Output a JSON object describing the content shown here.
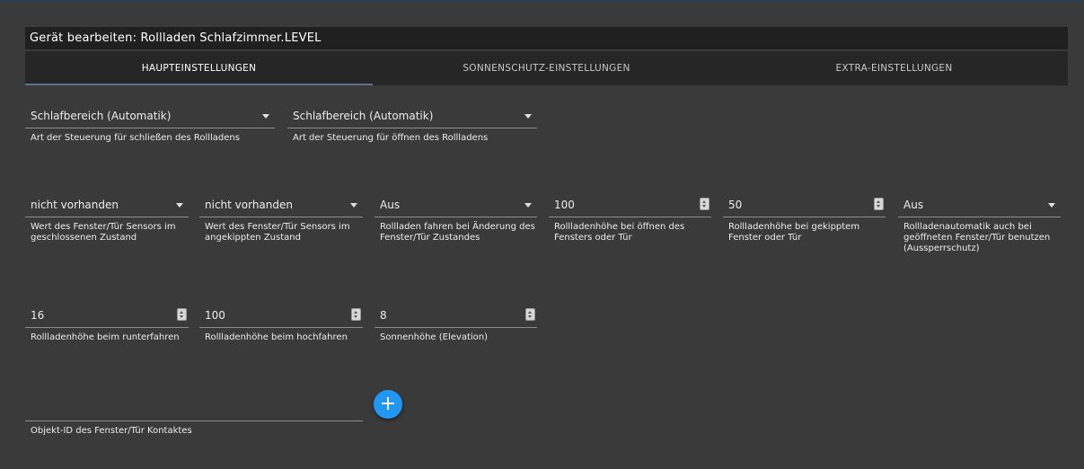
{
  "dialog": {
    "title": "Gerät bearbeiten: Rollladen Schlafzimmer.LEVEL"
  },
  "tabs": [
    {
      "label": "HAUPTEINSTELLUNGEN",
      "active": true
    },
    {
      "label": "SONNENSCHUTZ-EINSTELLUNGEN",
      "active": false
    },
    {
      "label": "EXTRA-EINSTELLUNGEN",
      "active": false
    }
  ],
  "row1": {
    "close_mode": {
      "value": "Schlafbereich (Automatik)",
      "label": "Art der Steuerung für schließen des Rollladens"
    },
    "open_mode": {
      "value": "Schlafbereich (Automatik)",
      "label": "Art der Steuerung für öffnen des Rollladens"
    }
  },
  "row2": {
    "sensor_closed": {
      "value": "nicht vorhanden",
      "label": "Wert des Fenster/Tür Sensors im geschlossenen Zustand"
    },
    "sensor_tilted": {
      "value": "nicht vorhanden",
      "label": "Wert des Fenster/Tür Sensors im angekippten Zustand"
    },
    "drive_on_change": {
      "value": "Aus",
      "label": "Rollladen fahren bei Änderung des Fenster/Tür Zustandes"
    },
    "height_open_window": {
      "value": "100",
      "label": "Rollladenhöhe bei öffnen des Fensters oder Tür"
    },
    "height_tilted_window": {
      "value": "50",
      "label": "Rollladenhöhe bei gekipptem Fenster oder Tür"
    },
    "lockout_protection": {
      "value": "Aus",
      "label": "Rollladenautomatik auch bei geöffneten Fenster/Tür benutzen (Aussperrschutz)"
    }
  },
  "row3": {
    "height_down": {
      "value": "16",
      "label": "Rollladenhöhe beim runterfahren"
    },
    "height_up": {
      "value": "100",
      "label": "Rollladenhöhe beim hochfahren"
    },
    "sun_elevation": {
      "value": "8",
      "label": "Sonnenhöhe (Elevation)"
    }
  },
  "contact": {
    "value": "",
    "label": "Objekt-ID des Fenster/Tür Kontaktes",
    "add_symbol": "+"
  }
}
